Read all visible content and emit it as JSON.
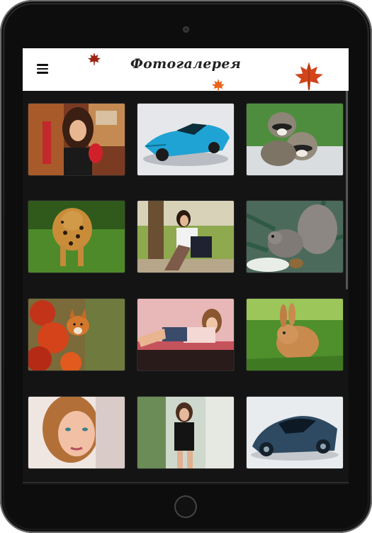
{
  "app": {
    "title": "Фотогалерея"
  },
  "header": {
    "menu_icon": "hamburger-menu-icon",
    "decorations": [
      "maple-leaf-icon",
      "maple-leaf-icon",
      "maple-leaf-icon"
    ]
  },
  "colors": {
    "screen_background": "#141414",
    "header_background": "#ffffff",
    "leaf_red": "#c0391b",
    "leaf_orange": "#e8651a"
  },
  "gallery": {
    "columns": 3,
    "items": [
      {
        "subject": "woman-red-glove"
      },
      {
        "subject": "blue-sports-car"
      },
      {
        "subject": "raccoons"
      },
      {
        "subject": "leopard"
      },
      {
        "subject": "woman-sitting-park"
      },
      {
        "subject": "squirrel"
      },
      {
        "subject": "fox-autumn"
      },
      {
        "subject": "woman-lying-car"
      },
      {
        "subject": "rabbit"
      },
      {
        "subject": "woman-portrait"
      },
      {
        "subject": "woman-black-top"
      },
      {
        "subject": "concept-car"
      }
    ]
  }
}
